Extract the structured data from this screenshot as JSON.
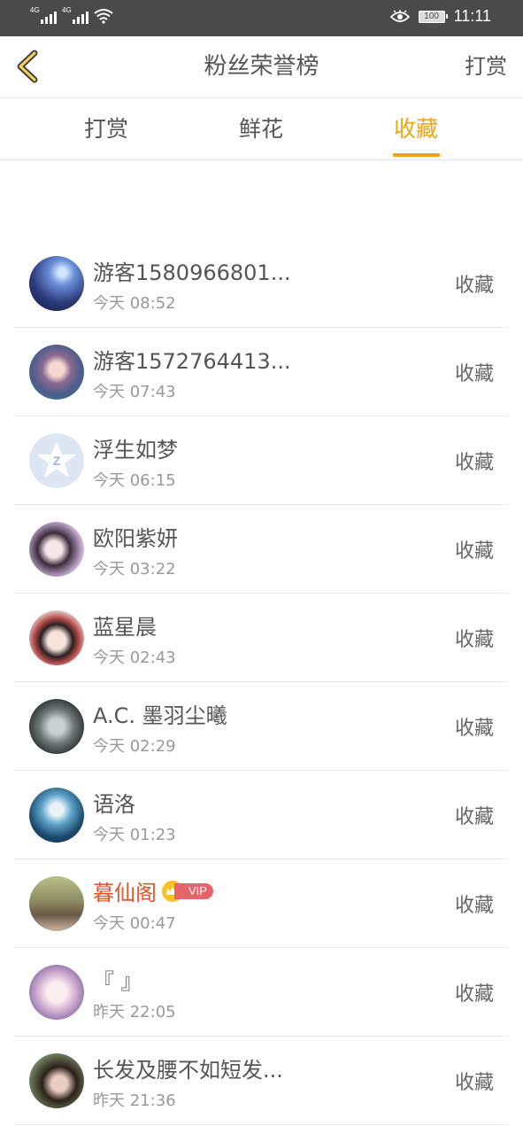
{
  "status_bar": {
    "signal1_label": "4G",
    "signal2_label": "4G",
    "battery_level": "100",
    "time": "11:11"
  },
  "navbar": {
    "title": "粉丝荣誉榜",
    "right_action": "打赏",
    "back_icon": "chevron-left-icon"
  },
  "tabs": [
    {
      "label": "打赏",
      "active": false
    },
    {
      "label": "鲜花",
      "active": false
    },
    {
      "label": "收藏",
      "active": true
    }
  ],
  "accent_color": "#f0a412",
  "list": [
    {
      "name": "游客1580966801...",
      "time": "今天 08:52",
      "action": "收藏",
      "vip": false
    },
    {
      "name": "游客1572764413...",
      "time": "今天 07:43",
      "action": "收藏",
      "vip": false
    },
    {
      "name": "浮生如梦",
      "time": "今天 06:15",
      "action": "收藏",
      "vip": false
    },
    {
      "name": "欧阳紫妍",
      "time": "今天 03:22",
      "action": "收藏",
      "vip": false
    },
    {
      "name": "蓝星晨",
      "time": "今天 02:43",
      "action": "收藏",
      "vip": false
    },
    {
      "name": "A.C. 墨羽尘曦",
      "time": "今天 02:29",
      "action": "收藏",
      "vip": false
    },
    {
      "name": "语洛",
      "time": "今天 01:23",
      "action": "收藏",
      "vip": false
    },
    {
      "name": "暮仙阁",
      "time": "今天 00:47",
      "action": "收藏",
      "vip": true,
      "vip_label": "VIP"
    },
    {
      "name": "『 』",
      "time": "昨天 22:05",
      "action": "收藏",
      "vip": false
    },
    {
      "name": "长发及腰不如短发...",
      "time": "昨天 21:36",
      "action": "收藏",
      "vip": false
    }
  ]
}
